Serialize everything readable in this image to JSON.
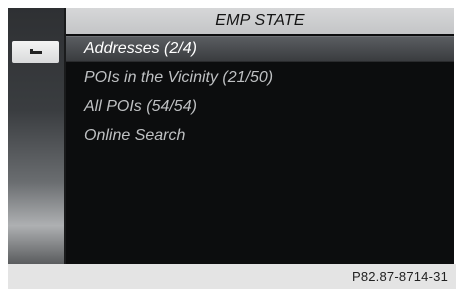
{
  "header": {
    "title": "EMP STATE"
  },
  "menu": {
    "items": [
      {
        "label": "Addresses (2/4)",
        "selected": true
      },
      {
        "label": "POIs in the Vicinity (21/50)",
        "selected": false
      },
      {
        "label": "All POIs (54/54)",
        "selected": false
      },
      {
        "label": "Online Search",
        "selected": false
      }
    ]
  },
  "sidebar": {
    "back_icon": "back-arrow-icon"
  },
  "footer": {
    "code": "P82.87-8714-31"
  },
  "colors": {
    "title_bar": "#c8c9cb",
    "selected_row": "#4a4c50",
    "screen_bg": "#0c0d0e",
    "item_text": "#bfc1c3"
  }
}
